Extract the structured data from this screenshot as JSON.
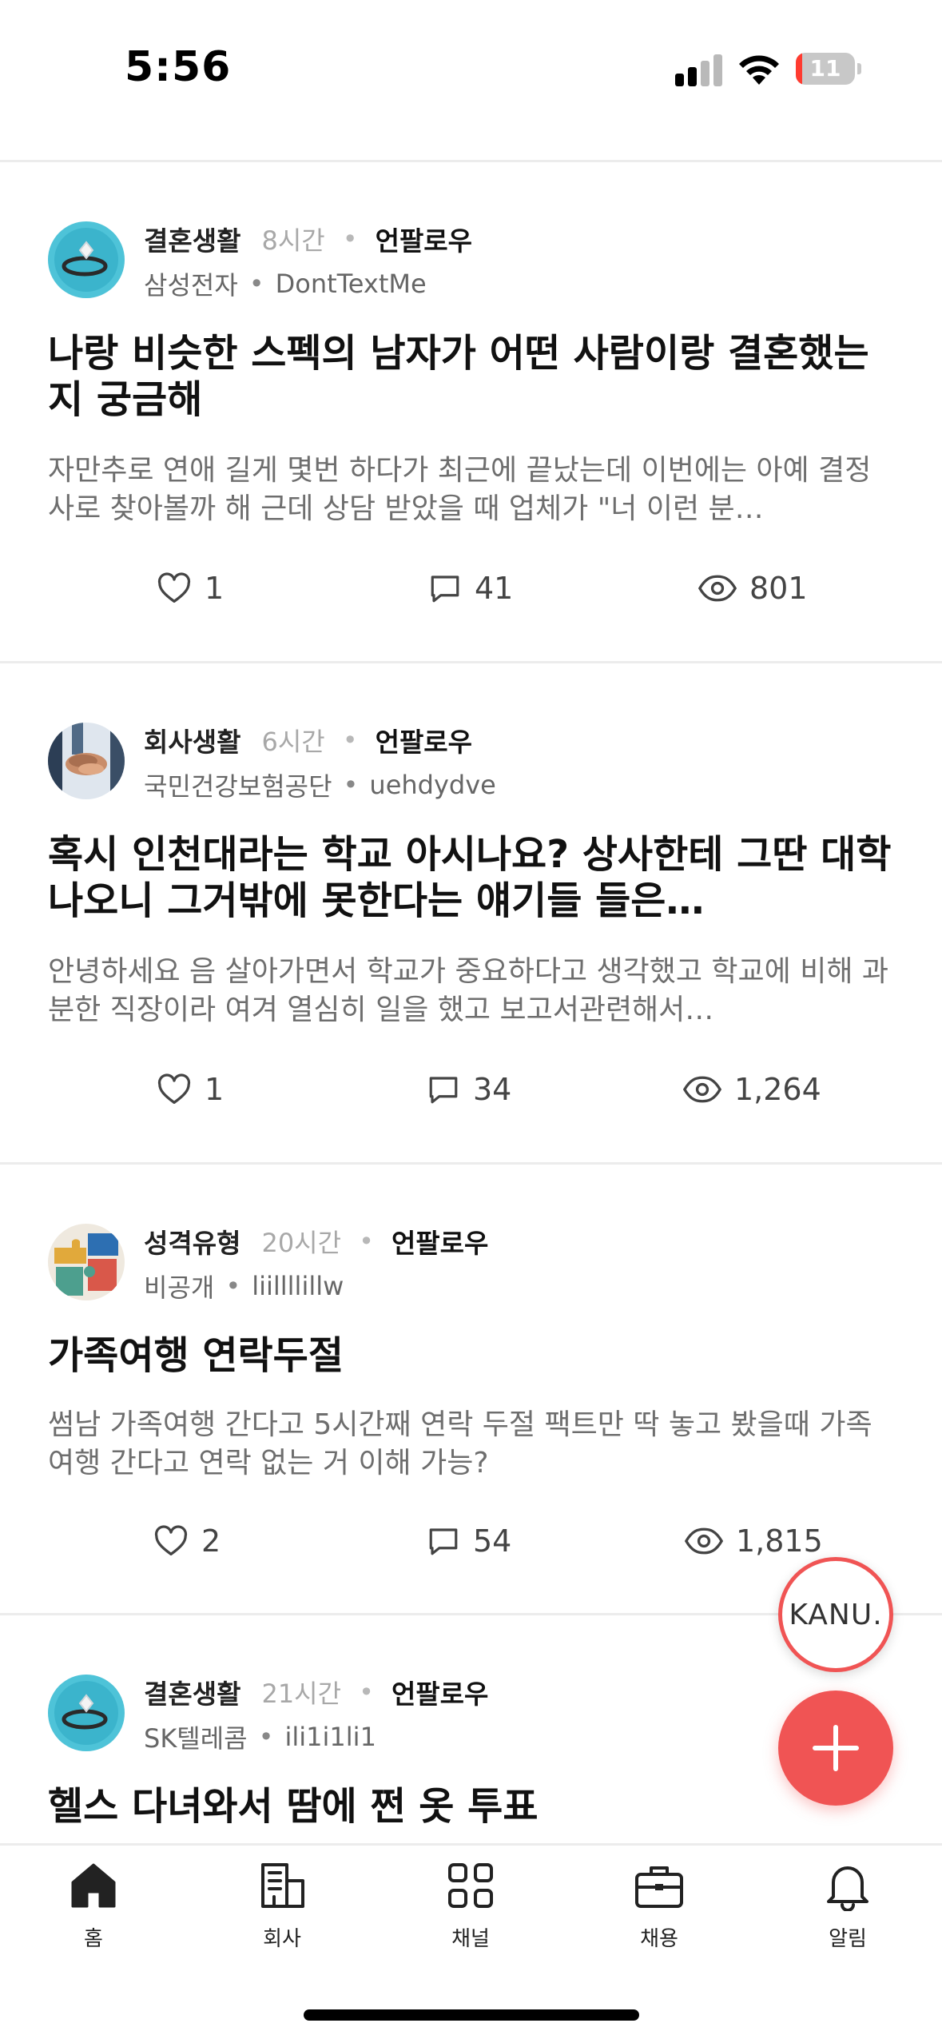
{
  "status_bar": {
    "time": "5:56",
    "battery": "11",
    "battery_level": 0.11
  },
  "posts": [
    {
      "channel": "결혼생활",
      "time": "8시간",
      "dot": "•",
      "follow": "언팔로우",
      "company": "삼성전자",
      "sep": "•",
      "author": "DontTextMe",
      "avatar_icon": "ring-icon",
      "title": "나랑 비슷한 스펙의 남자가 어떤 사람이랑 결혼했는지 궁금해",
      "excerpt": "자만추로 연애 길게 몇번 하다가 최근에 끝났는데 이번에는 아예 결정사로 찾아볼까 해  근데 상담 받았을 때 업체가 \"너 이런 분…",
      "likes": "1",
      "comments": "41",
      "views": "801"
    },
    {
      "channel": "회사생활",
      "time": "6시간",
      "dot": "•",
      "follow": "언팔로우",
      "company": "국민건강보험공단",
      "sep": "•",
      "author": "uehdydve",
      "avatar_icon": "team-hands-icon",
      "title": "혹시 인천대라는 학교 아시나요? 상사한테 그딴 대학나오니 그거밖에 못한다는 얘기들 들은…",
      "excerpt": "안녕하세요 음 살아가면서 학교가 중요하다고 생각했고 학교에 비해 과분한 직장이라 여겨 열심히 일을 했고 보고서관련해서…",
      "likes": "1",
      "comments": "34",
      "views": "1,264"
    },
    {
      "channel": "성격유형",
      "time": "20시간",
      "dot": "•",
      "follow": "언팔로우",
      "company": "비공개",
      "sep": "•",
      "author": "liillllillw",
      "avatar_icon": "puzzle-icon",
      "title": "가족여행 연락두절",
      "excerpt": "썸남 가족여행 간다고 5시간째 연락 두절  팩트만 딱 놓고 봤을때 가족 여행 간다고 연락 없는 거 이해 가능?",
      "likes": "2",
      "comments": "54",
      "views": "1,815"
    },
    {
      "channel": "결혼생활",
      "time": "21시간",
      "dot": "•",
      "follow": "언팔로우",
      "company": "SK텔레콤",
      "sep": "•",
      "author": "ili1i1li1",
      "avatar_icon": "ring-icon",
      "title": "헬스 다녀와서 땀에 쩐 옷 투표"
    }
  ],
  "floating": {
    "kanu_label": "KANU.",
    "fab_icon": "plus-icon"
  },
  "nav": [
    {
      "label": "홈",
      "icon": "home-icon"
    },
    {
      "label": "회사",
      "icon": "building-icon"
    },
    {
      "label": "채널",
      "icon": "grid-icon"
    },
    {
      "label": "채용",
      "icon": "briefcase-icon"
    },
    {
      "label": "알림",
      "icon": "bell-icon"
    }
  ],
  "colors": {
    "accent": "#f05454",
    "divider": "#ececec",
    "meta_gray": "#a8a8a8",
    "excerpt_gray": "#6e6e6e"
  }
}
